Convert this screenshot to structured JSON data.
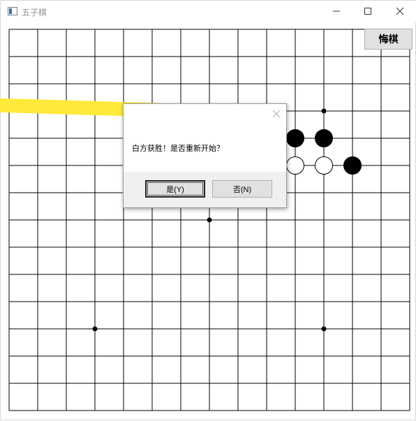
{
  "window": {
    "title": "五子棋"
  },
  "toolbar": {
    "undo_label": "悔棋"
  },
  "dialog": {
    "message": "白方获胜！是否重新开始？",
    "yes_label": "是(Y)",
    "no_label": "否(N)"
  },
  "board": {
    "size": 15,
    "star_points": [
      [
        7,
        7
      ],
      [
        3,
        3
      ],
      [
        11,
        3
      ],
      [
        3,
        11
      ],
      [
        11,
        11
      ]
    ],
    "stones": [
      {
        "col": 10,
        "row": 4,
        "color": "black"
      },
      {
        "col": 11,
        "row": 4,
        "color": "black"
      },
      {
        "col": 12,
        "row": 5,
        "color": "black"
      },
      {
        "col": 10,
        "row": 5,
        "color": "white"
      },
      {
        "col": 11,
        "row": 5,
        "color": "white"
      }
    ]
  },
  "colors": {
    "highlight": "#ffe93a",
    "grid": "#000000",
    "background": "#ffffff"
  }
}
